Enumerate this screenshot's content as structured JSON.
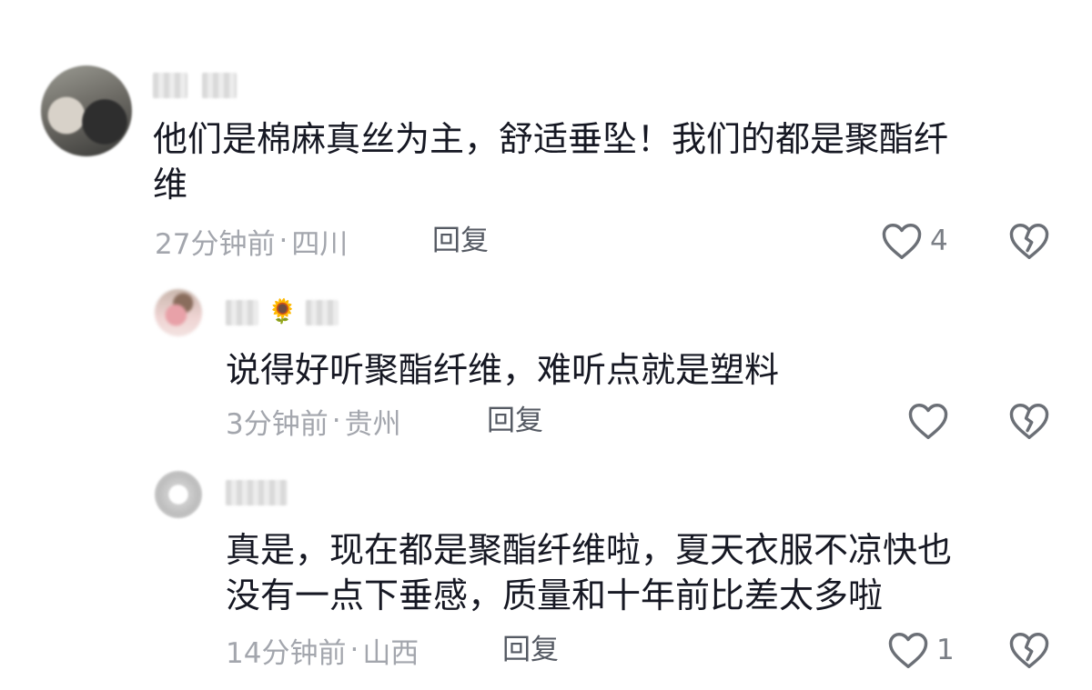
{
  "comments": [
    {
      "text": "他们是棉麻真丝为主，舒适垂坠！我们的都是聚酯纤\n维",
      "time": "27分钟前",
      "location": "四川",
      "reply_label": "回复",
      "like_count": "4"
    },
    {
      "text": "说得好听聚酯纤维，难听点就是塑料",
      "time": "3分钟前",
      "location": "贵州",
      "reply_label": "回复",
      "like_count": ""
    },
    {
      "text": "真是，现在都是聚酯纤维啦，夏天衣服不凉快也\n没有一点下垂感，质量和十年前比差太多啦",
      "time": "14分钟前",
      "location": "山西",
      "reply_label": "回复",
      "like_count": "1"
    }
  ],
  "separator": "·",
  "emoji": "🌻",
  "colors": {
    "text": "#161823",
    "meta": "#a3a6ad",
    "icon": "#6b6f76"
  }
}
